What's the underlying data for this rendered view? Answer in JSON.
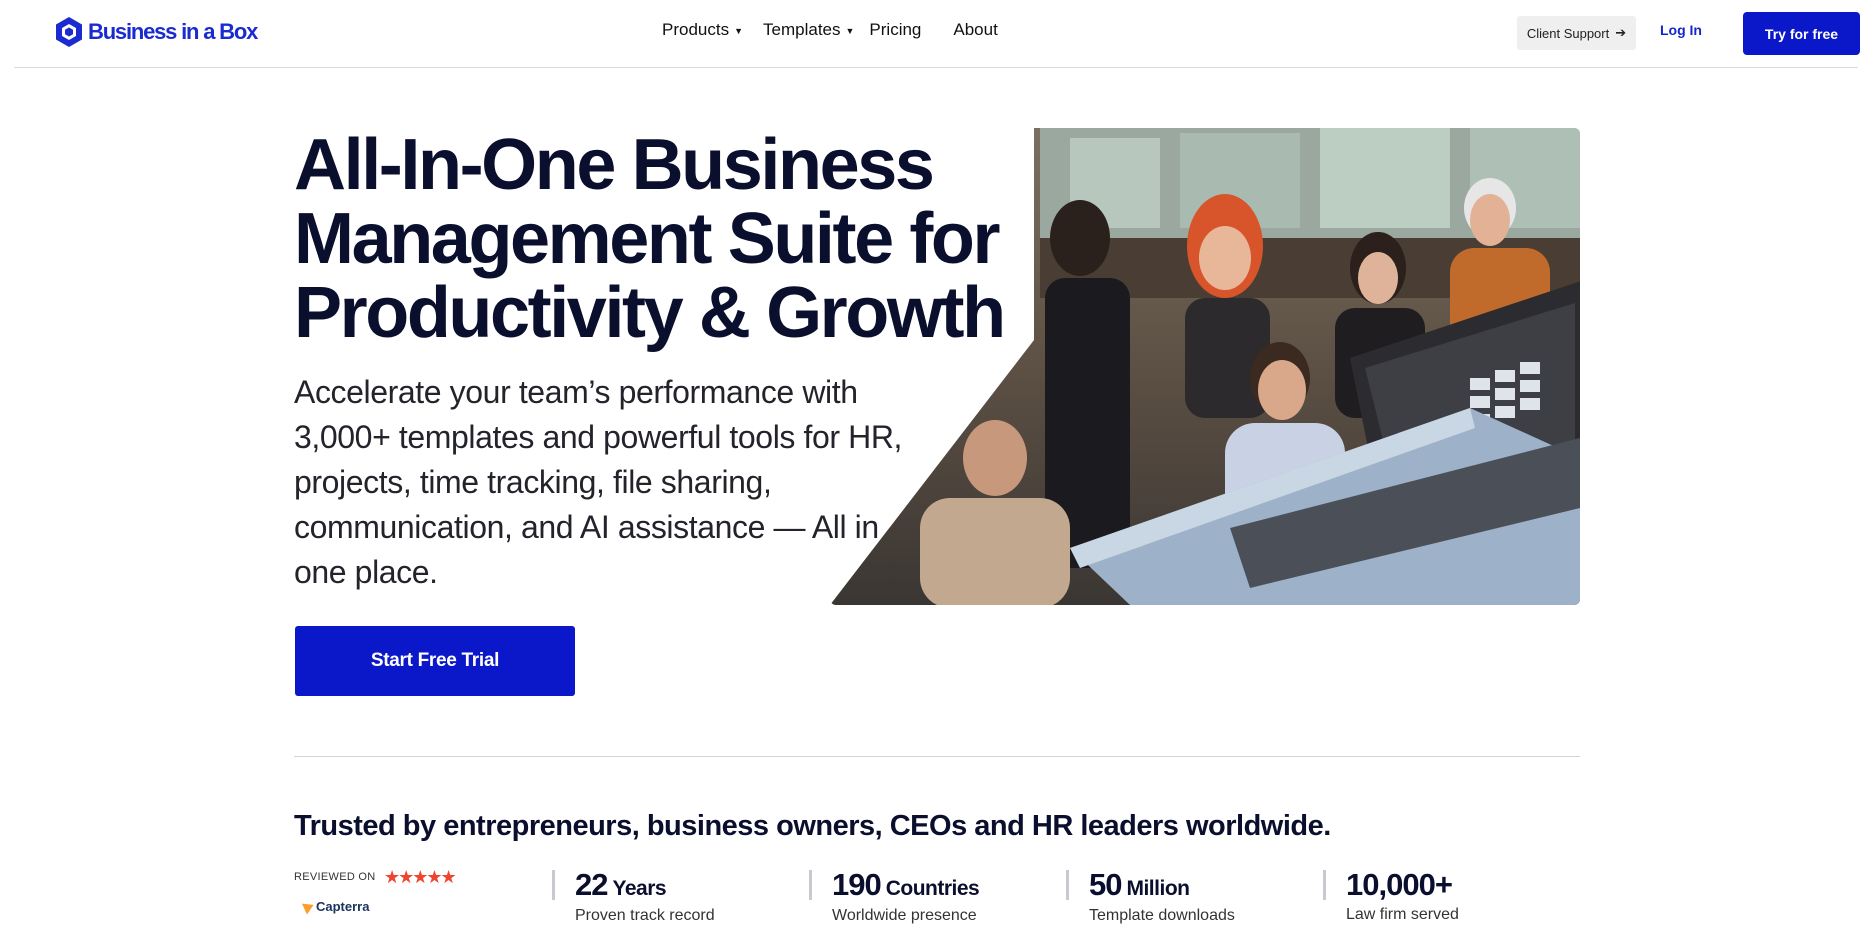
{
  "header": {
    "logo_text": "Business in a Box",
    "nav": {
      "products": "Products",
      "templates": "Templates",
      "pricing": "Pricing",
      "about": "About"
    },
    "client_support": "Client Support",
    "login": "Log In",
    "try_free": "Try for free"
  },
  "hero": {
    "title": "All-In-One Business Management Suite for Productivity & Growth",
    "subtitle": "Accelerate your team’s performance with 3,000+ templates and powerful tools for HR, projects, time tracking, file sharing, communication, and AI assistance — All in one place.",
    "cta": "Start Free Trial"
  },
  "trust": {
    "heading": "Trusted by entrepreneurs, business owners, CEOs and HR leaders worldwide.",
    "reviewed_on": "REVIEWED ON",
    "rating_stars": 5,
    "review_site": "Capterra",
    "stats": [
      {
        "number": "22",
        "unit": "Years",
        "desc": "Proven track record"
      },
      {
        "number": "190",
        "unit": "Countries",
        "desc": "Worldwide presence"
      },
      {
        "number": "50",
        "unit": "Million",
        "desc": "Template downloads"
      },
      {
        "number": "10,000+",
        "unit": "",
        "desc": "Law firm served"
      }
    ]
  },
  "colors": {
    "brand_blue": "#0b18c9",
    "heading_navy": "#0b0f2e",
    "star_red": "#ef4430"
  }
}
